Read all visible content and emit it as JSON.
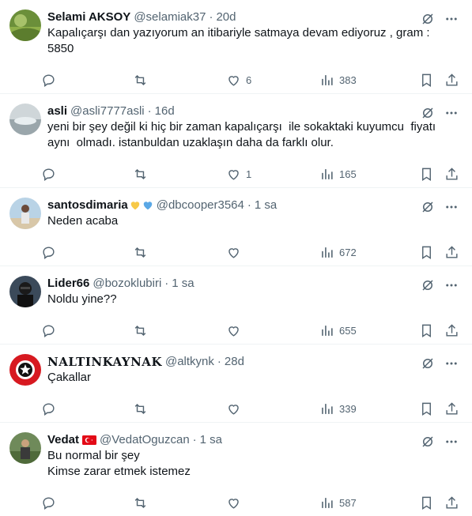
{
  "tweets": [
    {
      "name": "Selami AKSOY",
      "handle": "@selamiak37",
      "time": "20d",
      "text": [
        "Kapalıçarşı dan yazıyorum an itibariyle satmaya devam ediyoruz , gram :",
        "5850"
      ],
      "likes": "6",
      "views": "383"
    },
    {
      "name": "asli",
      "handle": "@asli7777asli",
      "time": "16d",
      "text": [
        "yeni bir şey değil ki hiç bir zaman kapalıçarşı  ile sokaktaki kuyumcu  fiyatı",
        "aynı  olmadı. istanbuldan uzaklaşın daha da farklı olur."
      ],
      "likes": "1",
      "views": "165"
    },
    {
      "name": "santosdimaria",
      "handle": "@dbcooper3564",
      "time": "1 sa",
      "text": [
        "Neden acaba"
      ],
      "likes": "",
      "views": "672"
    },
    {
      "name": "Lider66",
      "handle": "@bozoklubiri",
      "time": "1 sa",
      "text": [
        "Noldu yine??"
      ],
      "likes": "",
      "views": "655"
    },
    {
      "name": "NALTINKAYNAK",
      "handle": "@altkynk",
      "time": "28d",
      "text": [
        "Çakallar"
      ],
      "likes": "",
      "views": "339"
    },
    {
      "name": "Vedat",
      "handle": "@VedatOguzcan",
      "time": "1 sa",
      "text": [
        "Bu normal bir şey",
        "Kimse zarar etmek istemez"
      ],
      "likes": "",
      "views": "587"
    }
  ],
  "dot": "·",
  "colors": {
    "text": "#0f1419",
    "secondary": "#536471",
    "border": "#eff3f4"
  }
}
